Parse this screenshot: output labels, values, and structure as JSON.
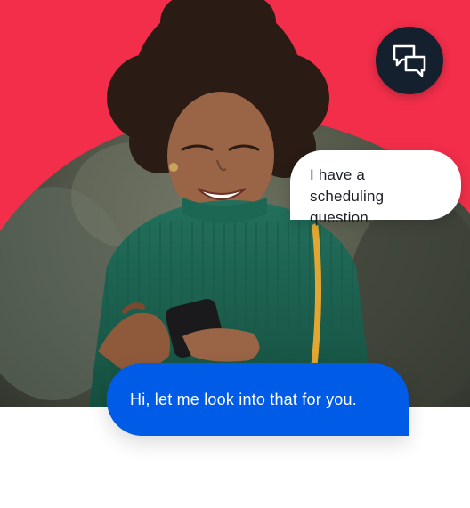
{
  "colors": {
    "brand_red": "#f22e4a",
    "badge_dark": "#15202f",
    "agent_bubble_blue": "#005ce6",
    "incoming_bubble_white": "#ffffff"
  },
  "badge": {
    "icon": "chat-bubbles-icon"
  },
  "messages": {
    "customer": "I have a scheduling question.",
    "agent": "Hi, let me look into that for you."
  },
  "photo": {
    "subject": "smiling woman in green sweater using a smartphone"
  }
}
